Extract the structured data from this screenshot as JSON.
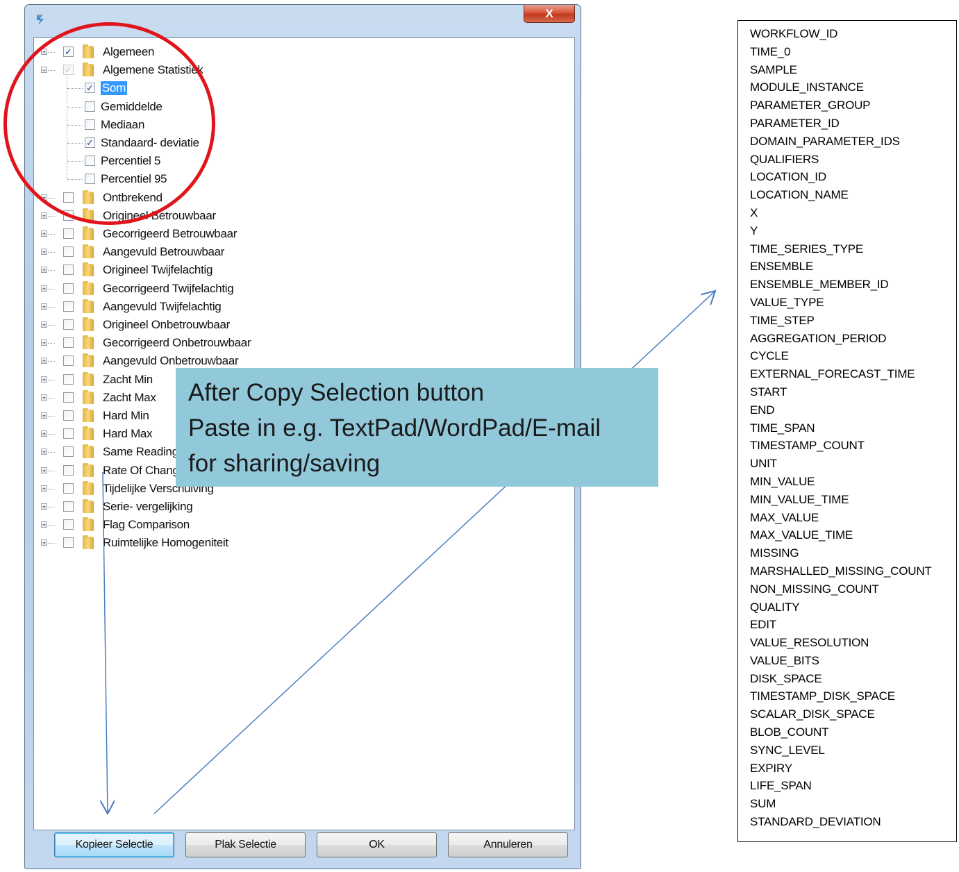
{
  "dialog": {
    "close_label": "X",
    "tree": [
      {
        "label": "Algemeen",
        "level": 0,
        "expander": "+",
        "checked": true,
        "dim": false,
        "folder": true
      },
      {
        "label": "Algemene Statistiek",
        "level": 0,
        "expander": "−",
        "checked": true,
        "dim": true,
        "folder": true
      },
      {
        "label": "Som",
        "level": 1,
        "checked": true,
        "dim": false,
        "folder": false,
        "selected": true
      },
      {
        "label": "Gemiddelde",
        "level": 1,
        "checked": false,
        "folder": false
      },
      {
        "label": "Mediaan",
        "level": 1,
        "checked": false,
        "folder": false
      },
      {
        "label": "Standaard- deviatie",
        "level": 1,
        "checked": true,
        "folder": false
      },
      {
        "label": "Percentiel 5",
        "level": 1,
        "checked": false,
        "folder": false
      },
      {
        "label": "Percentiel 95",
        "level": 1,
        "checked": false,
        "folder": false,
        "last": true
      },
      {
        "label": "Ontbrekend",
        "level": 0,
        "expander": "+",
        "checked": false,
        "folder": true
      },
      {
        "label": "Origineel Betrouwbaar",
        "level": 0,
        "expander": "+",
        "checked": false,
        "folder": true
      },
      {
        "label": "Gecorrigeerd Betrouwbaar",
        "level": 0,
        "expander": "+",
        "checked": false,
        "folder": true
      },
      {
        "label": "Aangevuld Betrouwbaar",
        "level": 0,
        "expander": "+",
        "checked": false,
        "folder": true
      },
      {
        "label": "Origineel Twijfelachtig",
        "level": 0,
        "expander": "+",
        "checked": false,
        "folder": true
      },
      {
        "label": "Gecorrigeerd Twijfelachtig",
        "level": 0,
        "expander": "+",
        "checked": false,
        "folder": true
      },
      {
        "label": "Aangevuld Twijfelachtig",
        "level": 0,
        "expander": "+",
        "checked": false,
        "folder": true
      },
      {
        "label": "Origineel Onbetrouwbaar",
        "level": 0,
        "expander": "+",
        "checked": false,
        "folder": true
      },
      {
        "label": "Gecorrigeerd Onbetrouwbaar",
        "level": 0,
        "expander": "+",
        "checked": false,
        "folder": true
      },
      {
        "label": "Aangevuld Onbetrouwbaar",
        "level": 0,
        "expander": "+",
        "checked": false,
        "folder": true
      },
      {
        "label": "Zacht Min",
        "level": 0,
        "expander": "+",
        "checked": false,
        "folder": true
      },
      {
        "label": "Zacht Max",
        "level": 0,
        "expander": "+",
        "checked": false,
        "folder": true
      },
      {
        "label": "Hard Min",
        "level": 0,
        "expander": "+",
        "checked": false,
        "folder": true
      },
      {
        "label": "Hard Max",
        "level": 0,
        "expander": "+",
        "checked": false,
        "folder": true
      },
      {
        "label": "Same Reading",
        "level": 0,
        "expander": "+",
        "checked": false,
        "folder": true
      },
      {
        "label": "Rate Of Change",
        "level": 0,
        "expander": "+",
        "checked": false,
        "folder": true
      },
      {
        "label": "Tijdelijke Verschuiving",
        "level": 0,
        "expander": "+",
        "checked": false,
        "folder": true
      },
      {
        "label": "Serie- vergelijking",
        "level": 0,
        "expander": "+",
        "checked": false,
        "folder": true
      },
      {
        "label": "Flag Comparison",
        "level": 0,
        "expander": "+",
        "checked": false,
        "folder": true
      },
      {
        "label": "Ruimtelijke Homogeniteit",
        "level": 0,
        "expander": "+",
        "checked": false,
        "folder": true
      }
    ],
    "buttons": {
      "copy": "Kopieer Selectie",
      "paste": "Plak Selectie",
      "ok": "OK",
      "cancel": "Annuleren"
    }
  },
  "callout": {
    "line1": "After Copy Selection button",
    "line2": "Paste in e.g. TextPad/WordPad/E-mail",
    "line3": "for sharing/saving"
  },
  "columns": [
    "WORKFLOW_ID",
    "TIME_0",
    "SAMPLE",
    "MODULE_INSTANCE",
    "PARAMETER_GROUP",
    "PARAMETER_ID",
    "DOMAIN_PARAMETER_IDS",
    "QUALIFIERS",
    "LOCATION_ID",
    "LOCATION_NAME",
    "X",
    "Y",
    "TIME_SERIES_TYPE",
    "ENSEMBLE",
    "ENSEMBLE_MEMBER_ID",
    "VALUE_TYPE",
    "TIME_STEP",
    "AGGREGATION_PERIOD",
    "CYCLE",
    "EXTERNAL_FORECAST_TIME",
    "START",
    "END",
    "TIME_SPAN",
    "TIMESTAMP_COUNT",
    "UNIT",
    "MIN_VALUE",
    "MIN_VALUE_TIME",
    "MAX_VALUE",
    "MAX_VALUE_TIME",
    "MISSING",
    "MARSHALLED_MISSING_COUNT",
    "NON_MISSING_COUNT",
    "QUALITY",
    "EDIT",
    "VALUE_RESOLUTION",
    "VALUE_BITS",
    "DISK_SPACE",
    "TIMESTAMP_DISK_SPACE",
    "SCALAR_DISK_SPACE",
    "BLOB_COUNT",
    "SYNC_LEVEL",
    "EXPIRY",
    "LIFE_SPAN",
    "SUM",
    "STANDARD_DEVIATION"
  ],
  "colors": {
    "circle": "#e0141b",
    "callout_bg": "#92c9da",
    "arrow": "#4a7fc1",
    "selection": "#3399ff"
  }
}
